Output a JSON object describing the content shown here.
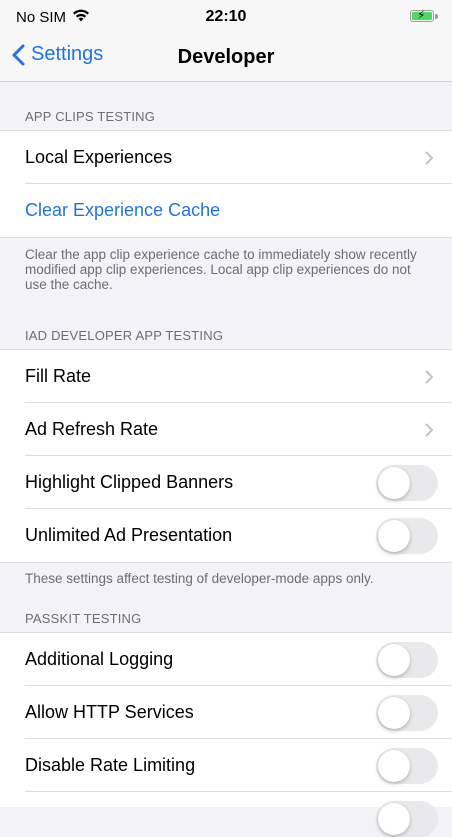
{
  "status_bar": {
    "carrier": "No SIM",
    "time": "22:10"
  },
  "nav": {
    "back_label": "Settings",
    "title": "Developer"
  },
  "sections": {
    "app_clips": {
      "header": "APP CLIPS TESTING",
      "items": [
        {
          "label": "Local Experiences",
          "accessory": "chevron"
        },
        {
          "label": "Clear Experience Cache",
          "accessory": "none"
        }
      ],
      "footer": "Clear the app clip experience cache to immediately show recently modified app clip experiences. Local app clip experiences do not use the cache."
    },
    "iad": {
      "header": "IAD DEVELOPER APP TESTING",
      "items": [
        {
          "label": "Fill Rate",
          "accessory": "chevron"
        },
        {
          "label": "Ad Refresh Rate",
          "accessory": "chevron"
        },
        {
          "label": "Highlight Clipped Banners",
          "accessory": "toggle",
          "on": false
        },
        {
          "label": "Unlimited Ad Presentation",
          "accessory": "toggle",
          "on": false
        }
      ],
      "footer": "These settings affect testing of developer-mode apps only."
    },
    "passkit": {
      "header": "PASSKIT TESTING",
      "items": [
        {
          "label": "Additional Logging",
          "accessory": "toggle",
          "on": false
        },
        {
          "label": "Allow HTTP Services",
          "accessory": "toggle",
          "on": false
        },
        {
          "label": "Disable Rate Limiting",
          "accessory": "toggle",
          "on": false
        }
      ]
    }
  },
  "colors": {
    "accent": "#1f73e6",
    "background": "#f2f2f7",
    "toggle_off": "#e9e9eb",
    "battery_fill": "#4cd964"
  }
}
